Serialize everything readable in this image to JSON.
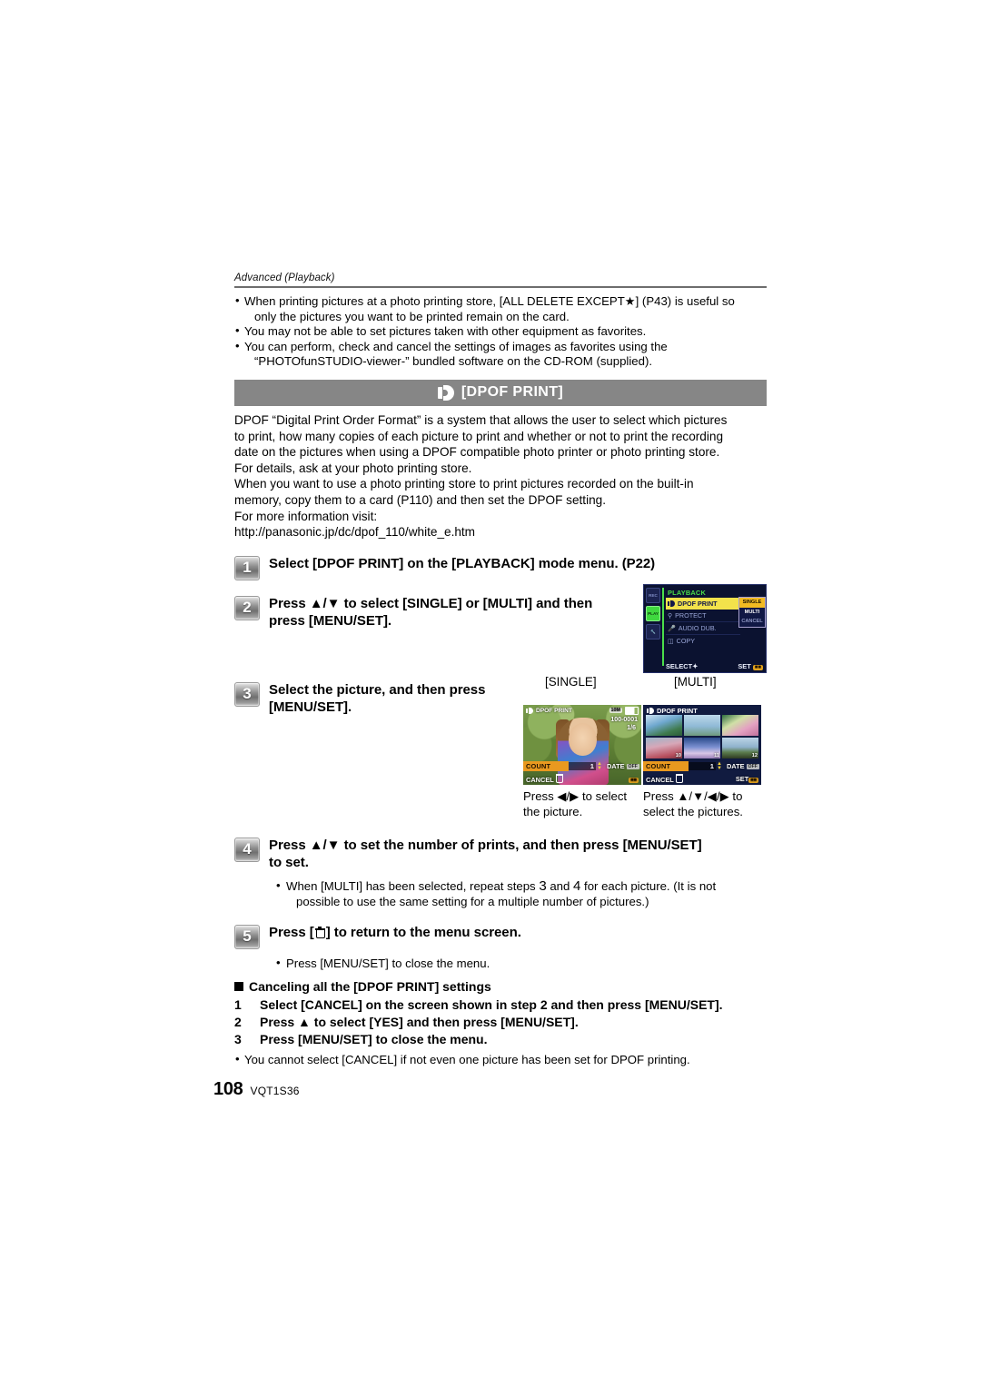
{
  "running_head": "Advanced (Playback)",
  "intro_bullets": [
    {
      "line1": "When printing pictures at a photo printing store, [ALL DELETE EXCEPT★] (P43) is useful so",
      "line2": "only the pictures you want to be printed remain on the card."
    },
    {
      "line1": "You may not be able to set pictures taken with other equipment as favorites.",
      "line2": ""
    },
    {
      "line1": "You can perform, check and cancel the settings of images as favorites using the",
      "line2": "“PHOTOfunSTUDIO-viewer-” bundled software on the CD-ROM (supplied)."
    }
  ],
  "banner": {
    "title": "[DPOF PRINT]",
    "icon": "dpof-icon",
    "bg_color": "#868686"
  },
  "description": [
    "DPOF “Digital Print Order Format” is a system that allows the user to select which pictures",
    "to print, how many copies of each picture to print and whether or not to print the recording",
    "date on the pictures when using a DPOF compatible photo printer or photo printing store.",
    "For details, ask at your photo printing store.",
    "When you want to use a photo printing store to print pictures recorded on the built-in",
    "memory, copy them to a card (P110) and then set the DPOF setting.",
    "For more information visit:",
    "http://panasonic.jp/dc/dpof_110/white_e.htm"
  ],
  "steps": [
    {
      "number": "1",
      "lines": [
        "Select [DPOF PRINT] on the [PLAYBACK] mode menu. (P22)"
      ]
    },
    {
      "number": "2",
      "lines": [
        "Press ▲/▼ to select [SINGLE] or [MULTI] and then",
        "press [MENU/SET]."
      ]
    },
    {
      "number": "3",
      "lines": [
        "Select the picture, and then press",
        "[MENU/SET]."
      ]
    },
    {
      "number": "4",
      "lines": [
        "Press ▲/▼ to set the number of prints, and then press [MENU/SET]",
        "to set."
      ]
    },
    {
      "number": "5",
      "lines": [
        "Press [",
        "] to return to the menu screen."
      ]
    }
  ],
  "step4_note": {
    "line1": "When [MULTI] has been selected, repeat steps",
    "num_a": "3",
    "mid": "and",
    "num_b": "4",
    "tail": "for each picture. (It is not",
    "line2": "possible to use the same setting for a multiple number of pictures.)"
  },
  "step5_note": "Press [MENU/SET] to close the menu.",
  "menu_screen": {
    "title": "PLAYBACK",
    "rows": [
      {
        "icon": "dpof-icon",
        "label": "DPOF PRINT",
        "selected": true
      },
      {
        "icon": "key-icon",
        "label": "PROTECT",
        "selected": false
      },
      {
        "icon": "mic-icon",
        "label": "AUDIO DUB.",
        "selected": false
      },
      {
        "icon": "card-icon",
        "label": "COPY",
        "selected": false
      }
    ],
    "submenu": [
      {
        "label": "SINGLE",
        "selected": true
      },
      {
        "label": "MULTI",
        "selected": false
      },
      {
        "label": "CANCEL",
        "selected": false
      }
    ],
    "rail_tabs": [
      "REC",
      "PLAY",
      "SETUP"
    ],
    "foot_left": "SELECT",
    "foot_left_icon": "✦",
    "foot_right": "SET",
    "foot_right_icon": "menu-button-icon"
  },
  "shot_labels": {
    "single": "[SINGLE]",
    "multi": "[MULTI]"
  },
  "single_screen": {
    "title": "DPOF PRINT",
    "resolution_badge": "10M",
    "filename": "100-0001",
    "counter": "1/6",
    "count_label": "COUNT",
    "count_value": "1",
    "date_label": "DATE",
    "date_value": "OFF",
    "cancel_label": "CANCEL",
    "set_label": "SET"
  },
  "multi_screen": {
    "title": "DPOF PRINT",
    "thumb_numbers": [
      "",
      "",
      "",
      "10",
      "11",
      "12"
    ],
    "count_label": "COUNT",
    "count_value": "1",
    "date_label": "DATE",
    "date_value": "OFF",
    "cancel_label": "CANCEL",
    "set_label": "SET"
  },
  "captions": {
    "single": "Press ◀/▶ to select the picture.",
    "multi": "Press ▲/▼/◀/▶ to select the pictures."
  },
  "cancel_section": {
    "heading": "Canceling all the [DPOF PRINT] settings",
    "items": [
      {
        "n": "1",
        "text": "Select [CANCEL] on the screen shown in step 2 and then press [MENU/SET]."
      },
      {
        "n": "2",
        "text": "Press ▲ to select [YES] and then press [MENU/SET]."
      },
      {
        "n": "3",
        "text": "Press [MENU/SET] to close the menu."
      }
    ],
    "note": "You cannot select [CANCEL] if not even one picture has been set for DPOF printing."
  },
  "footer": {
    "page_number": "108",
    "part_number": "VQT1S36"
  }
}
